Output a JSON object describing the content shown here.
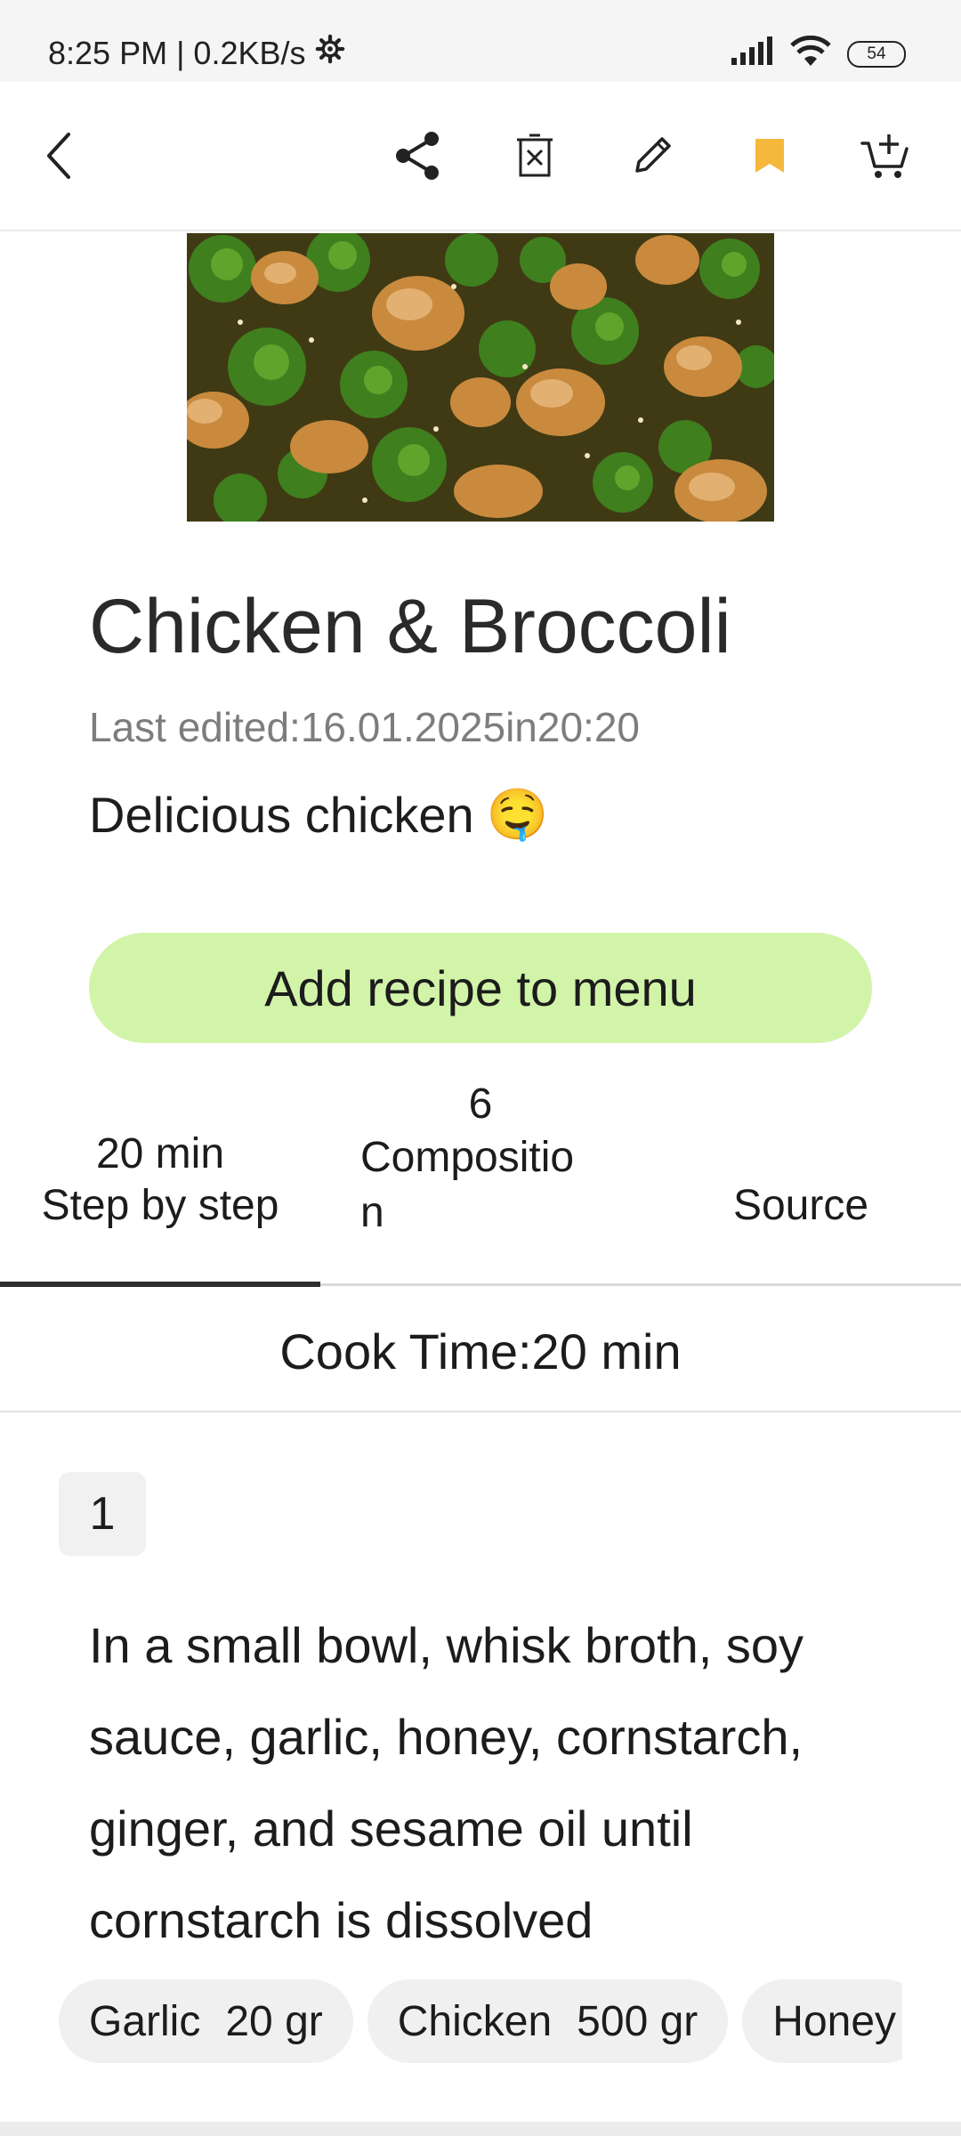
{
  "status_bar": {
    "time": "8:25 PM | 0.2KB/s",
    "battery": "54"
  },
  "toolbar": {
    "icons": [
      "back-icon",
      "share-icon",
      "delete-icon",
      "edit-icon",
      "bookmark-icon",
      "add-to-cart-icon"
    ],
    "bookmark_color": "#F6B83C"
  },
  "recipe": {
    "title": "Chicken & Broccoli",
    "last_edited": "Last edited:16.01.2025in20:20",
    "description": "Delicious chicken",
    "emoji": "🤤",
    "add_button": "Add recipe to menu"
  },
  "tabs": [
    {
      "top": "20 min",
      "label": "Step by step"
    },
    {
      "top": "6",
      "label": "Compositio\nn"
    },
    {
      "top": "",
      "label": "Source"
    }
  ],
  "cook_time": "Cook Time:20 min",
  "step": {
    "number": "1",
    "text": "In a small bowl, whisk broth, soy sauce, garlic, honey, cornstarch, ginger, and sesame oil until cornstarch is dissolved"
  },
  "ingredients": [
    {
      "name": "Garlic",
      "amount": "20 gr"
    },
    {
      "name": "Chicken",
      "amount": "500 gr"
    },
    {
      "name": "Honey",
      "amount": ""
    }
  ],
  "colors": {
    "accent_button": "#D2F4A9",
    "bookmark": "#F6B83C"
  }
}
